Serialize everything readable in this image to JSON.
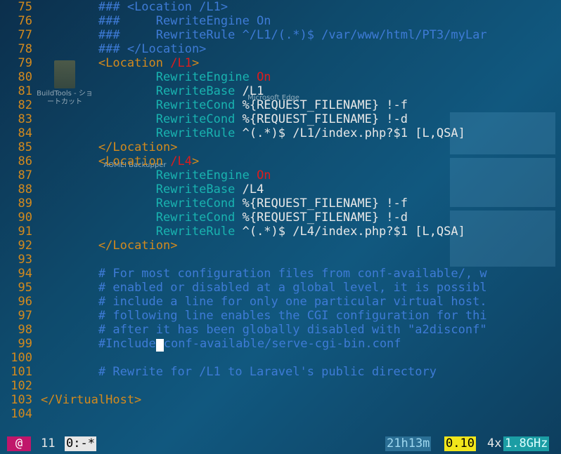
{
  "desktop": {
    "icons": [
      {
        "label": "BuildTools - ショートカット"
      },
      {
        "label": "AOMEI Backupper"
      },
      {
        "label": "Microsoft Edge"
      }
    ]
  },
  "editor": {
    "lines": [
      {
        "n": "75",
        "tokens": [
          {
            "t": "        ",
            "c": "c-text"
          },
          {
            "t": "### <Location /L1>",
            "c": "c-comment"
          }
        ]
      },
      {
        "n": "76",
        "tokens": [
          {
            "t": "        ",
            "c": "c-text"
          },
          {
            "t": "###     RewriteEngine On",
            "c": "c-comment"
          }
        ]
      },
      {
        "n": "77",
        "tokens": [
          {
            "t": "        ",
            "c": "c-text"
          },
          {
            "t": "###     RewriteRule ^/L1/(.*)$ /var/www/html/PT3/myLar",
            "c": "c-comment"
          }
        ]
      },
      {
        "n": "78",
        "tokens": [
          {
            "t": "        ",
            "c": "c-text"
          },
          {
            "t": "### </Location>",
            "c": "c-comment"
          }
        ]
      },
      {
        "n": "79",
        "tokens": [
          {
            "t": "        ",
            "c": "c-text"
          },
          {
            "t": "<Location ",
            "c": "c-tag"
          },
          {
            "t": "/L1",
            "c": "c-path"
          },
          {
            "t": ">",
            "c": "c-tag"
          }
        ]
      },
      {
        "n": "80",
        "tokens": [
          {
            "t": "                ",
            "c": "c-text"
          },
          {
            "t": "RewriteEngine ",
            "c": "c-dir"
          },
          {
            "t": "On",
            "c": "c-on"
          }
        ]
      },
      {
        "n": "81",
        "tokens": [
          {
            "t": "                ",
            "c": "c-text"
          },
          {
            "t": "RewriteBase ",
            "c": "c-dir"
          },
          {
            "t": "/L1",
            "c": "c-text"
          }
        ]
      },
      {
        "n": "82",
        "tokens": [
          {
            "t": "                ",
            "c": "c-text"
          },
          {
            "t": "RewriteCond ",
            "c": "c-dir"
          },
          {
            "t": "%{REQUEST_FILENAME} !-f",
            "c": "c-text"
          }
        ]
      },
      {
        "n": "83",
        "tokens": [
          {
            "t": "                ",
            "c": "c-text"
          },
          {
            "t": "RewriteCond ",
            "c": "c-dir"
          },
          {
            "t": "%{REQUEST_FILENAME} !-d",
            "c": "c-text"
          }
        ]
      },
      {
        "n": "84",
        "tokens": [
          {
            "t": "                ",
            "c": "c-text"
          },
          {
            "t": "RewriteRule ",
            "c": "c-dir"
          },
          {
            "t": "^(.*)$ /L1/index.php?$1 [L,QSA]",
            "c": "c-text"
          }
        ]
      },
      {
        "n": "85",
        "tokens": [
          {
            "t": "        ",
            "c": "c-text"
          },
          {
            "t": "</Location>",
            "c": "c-tag"
          }
        ]
      },
      {
        "n": "86",
        "tokens": [
          {
            "t": "        ",
            "c": "c-text"
          },
          {
            "t": "<Location ",
            "c": "c-tag"
          },
          {
            "t": "/L4",
            "c": "c-path"
          },
          {
            "t": ">",
            "c": "c-tag"
          }
        ]
      },
      {
        "n": "87",
        "tokens": [
          {
            "t": "                ",
            "c": "c-text"
          },
          {
            "t": "RewriteEngine ",
            "c": "c-dir"
          },
          {
            "t": "On",
            "c": "c-on"
          }
        ]
      },
      {
        "n": "88",
        "tokens": [
          {
            "t": "                ",
            "c": "c-text"
          },
          {
            "t": "RewriteBase ",
            "c": "c-dir"
          },
          {
            "t": "/L4",
            "c": "c-text"
          }
        ]
      },
      {
        "n": "89",
        "tokens": [
          {
            "t": "                ",
            "c": "c-text"
          },
          {
            "t": "RewriteCond ",
            "c": "c-dir"
          },
          {
            "t": "%{REQUEST_FILENAME} !-f",
            "c": "c-text"
          }
        ]
      },
      {
        "n": "90",
        "tokens": [
          {
            "t": "                ",
            "c": "c-text"
          },
          {
            "t": "RewriteCond ",
            "c": "c-dir"
          },
          {
            "t": "%{REQUEST_FILENAME} !-d",
            "c": "c-text"
          }
        ]
      },
      {
        "n": "91",
        "tokens": [
          {
            "t": "                ",
            "c": "c-text"
          },
          {
            "t": "RewriteRule ",
            "c": "c-dir"
          },
          {
            "t": "^(.*)$ /L4/index.php?$1 [L,QSA]",
            "c": "c-text"
          }
        ]
      },
      {
        "n": "92",
        "tokens": [
          {
            "t": "        ",
            "c": "c-text"
          },
          {
            "t": "</Location>",
            "c": "c-tag"
          }
        ]
      },
      {
        "n": "93",
        "tokens": []
      },
      {
        "n": "94",
        "tokens": [
          {
            "t": "        ",
            "c": "c-text"
          },
          {
            "t": "# For most configuration files from conf-available/, w",
            "c": "c-comment"
          }
        ]
      },
      {
        "n": "95",
        "tokens": [
          {
            "t": "        ",
            "c": "c-text"
          },
          {
            "t": "# enabled or disabled at a global level, it is possibl",
            "c": "c-comment"
          }
        ]
      },
      {
        "n": "96",
        "tokens": [
          {
            "t": "        ",
            "c": "c-text"
          },
          {
            "t": "# include a line for only one particular virtual host.",
            "c": "c-comment"
          }
        ]
      },
      {
        "n": "97",
        "tokens": [
          {
            "t": "        ",
            "c": "c-text"
          },
          {
            "t": "# following line enables the CGI configuration for thi",
            "c": "c-comment"
          }
        ]
      },
      {
        "n": "98",
        "tokens": [
          {
            "t": "        ",
            "c": "c-text"
          },
          {
            "t": "# after it has been globally disabled with \"a2disconf\"",
            "c": "c-comment"
          }
        ]
      },
      {
        "n": "99",
        "tokens": [
          {
            "t": "        ",
            "c": "c-text"
          },
          {
            "t": "#Include",
            "c": "c-comment"
          },
          {
            "t": " ",
            "c": "cursor"
          },
          {
            "t": "conf-available/serve-cgi-bin.conf",
            "c": "c-comment"
          }
        ]
      },
      {
        "n": "100",
        "tokens": []
      },
      {
        "n": "101",
        "tokens": [
          {
            "t": "        ",
            "c": "c-text"
          },
          {
            "t": "# Rewrite for /L1 to Laravel's public directory",
            "c": "c-comment"
          }
        ]
      },
      {
        "n": "102",
        "tokens": []
      },
      {
        "n": "103",
        "tokens": [
          {
            "t": "</VirtualHost>",
            "c": "c-tag"
          }
        ]
      },
      {
        "n": "104",
        "tokens": []
      }
    ]
  },
  "statusbar": {
    "session_icon": "@",
    "window_count": "11",
    "window_name": "0:-*",
    "uptime": "21h13m",
    "load": "0.10",
    "cpu_count": "4x",
    "cpu_freq": "1.8GHz",
    "colors": {
      "session_bg": "#c0166a",
      "window_bg": "#e6e6e6",
      "uptime_bg": "#2b6f95",
      "load_bg": "#f2e61b",
      "freq_bg": "#1b9da4"
    }
  }
}
